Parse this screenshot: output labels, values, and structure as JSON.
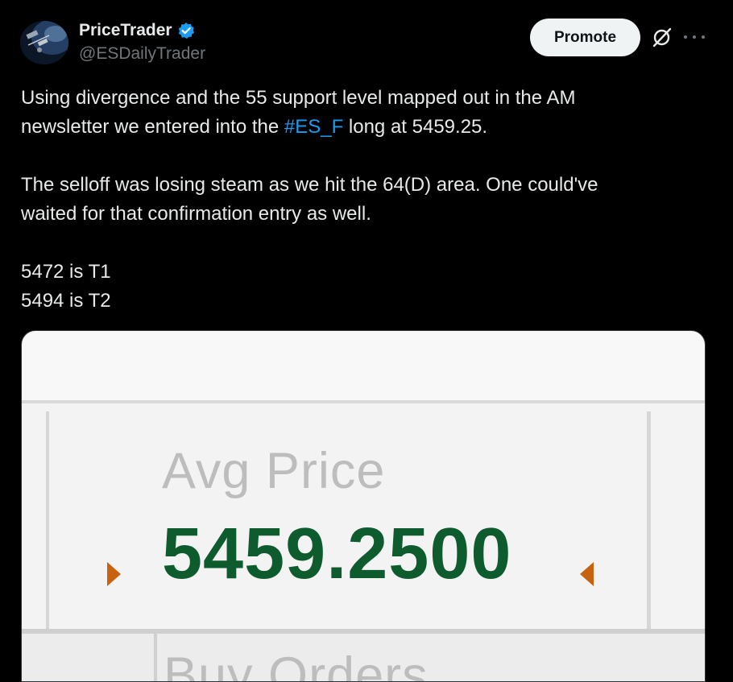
{
  "author": {
    "name": "PriceTrader",
    "handle": "@ESDailyTrader",
    "verified_icon": "verified-badge-icon",
    "verified_color": "#1d9bf0"
  },
  "actions": {
    "promote_label": "Promote",
    "grok_icon": "grok-icon",
    "more_icon": "more-dots-icon"
  },
  "tweet": {
    "line1_pre": "Using divergence and the 55 support level mapped out in the AM",
    "line2_pre": "newsletter we entered into the ",
    "hashtag": "#ES_F",
    "line2_post": " long at 5459.25.",
    "para2_line1": "The selloff was losing steam as we hit the 64(D) area. One could've",
    "para2_line2": "waited for that confirmation entry as well.",
    "target1": "5472 is T1",
    "target2": "5494 is T2"
  },
  "media": {
    "avg_label": "Avg Price",
    "avg_value": "5459.2500",
    "bottom_label": "Buy Orders",
    "value_color": "#0e5c2e",
    "arrow_color": "#c8620f"
  }
}
